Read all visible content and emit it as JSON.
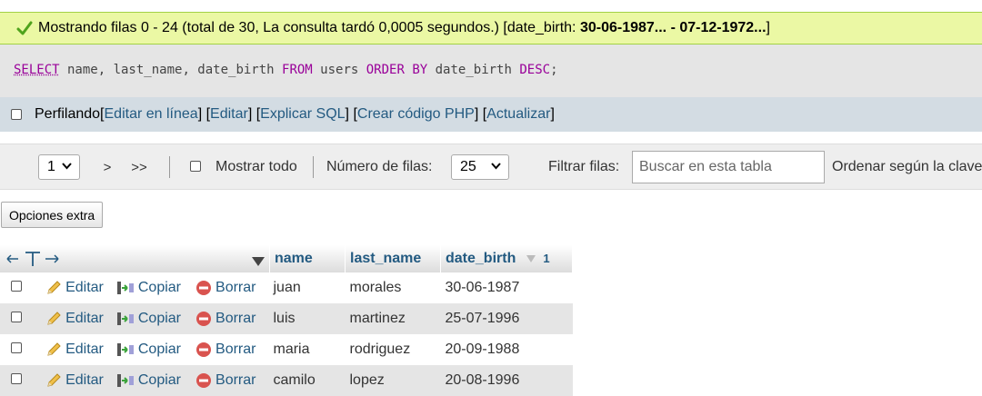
{
  "success": {
    "message": "Mostrando filas 0 - 24 (total de 30, La consulta tardó 0,0005 segundos.) [date_birth: ",
    "range": "30-06-1987... - 07-12-1972...",
    "close": "]"
  },
  "sql": {
    "select": "SELECT",
    "cols": " name, last_name, date_birth ",
    "from": "FROM",
    "table": " users ",
    "orderby": "ORDER BY",
    "ordercol": " date_birth ",
    "desc": "DESC",
    "end": ";"
  },
  "profiling": {
    "label": "Perfilando",
    "open1": " [ ",
    "edit_inline": "Editar en línea",
    "sep1": " ] [ ",
    "edit": "Editar",
    "sep2": " ] [ ",
    "explain": "Explicar SQL",
    "sep3": " ] [ ",
    "php": "Crear código PHP",
    "sep4": " ] [ ",
    "refresh": "Actualizar",
    "close": " ]"
  },
  "nav": {
    "page": "1",
    "next": ">",
    "last": ">>",
    "show_all": "Mostrar todo",
    "rows_label": "Número de filas:",
    "rows_value": "25",
    "filter_label": "Filtrar filas:",
    "search_placeholder": "Buscar en esta tabla",
    "sort_label": "Ordenar según la clave"
  },
  "extra_options": "Opciones extra",
  "table": {
    "headers": [
      "name",
      "last_name",
      "date_birth"
    ],
    "sort_index": "1",
    "actions": {
      "edit": "Editar",
      "copy": "Copiar",
      "delete": "Borrar"
    },
    "rows": [
      {
        "name": "juan",
        "last_name": "morales",
        "date_birth": "30-06-1987"
      },
      {
        "name": "luis",
        "last_name": "martinez",
        "date_birth": "25-07-1996"
      },
      {
        "name": "maria",
        "last_name": "rodriguez",
        "date_birth": "20-09-1988"
      },
      {
        "name": "camilo",
        "last_name": "lopez",
        "date_birth": "20-08-1996"
      }
    ]
  },
  "colors": {
    "success_bg": "#ebf8a4",
    "link": "#235a81",
    "keyword": "#990099",
    "profiling_bg": "#d3dce3",
    "delete_icon": "#d9534f"
  }
}
